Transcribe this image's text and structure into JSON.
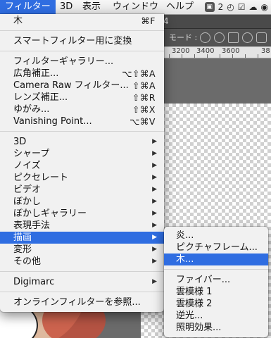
{
  "menubar": {
    "items": [
      "フィルター",
      "3D",
      "表示",
      "ウィンドウ",
      "ヘルプ"
    ],
    "active_index": 0,
    "tray": {
      "badge": "2"
    }
  },
  "document": {
    "tab_fragment": "4",
    "mode_label": "モード :",
    "ruler_labels": [
      "3200",
      "3400",
      "3600",
      "38"
    ]
  },
  "main_menu": {
    "group1": [
      {
        "label": "木",
        "shortcut": "⌘F"
      }
    ],
    "group2": [
      {
        "label": "スマートフィルター用に変換"
      }
    ],
    "group3": [
      {
        "label": "フィルターギャラリー..."
      },
      {
        "label": "広角補正...",
        "shortcut": "⌥⇧⌘A"
      },
      {
        "label": "Camera Raw フィルター...",
        "shortcut": "⇧⌘A"
      },
      {
        "label": "レンズ補正...",
        "shortcut": "⇧⌘R"
      },
      {
        "label": "ゆがみ...",
        "shortcut": "⇧⌘X"
      },
      {
        "label": "Vanishing Point...",
        "shortcut": "⌥⌘V"
      }
    ],
    "group4": [
      {
        "label": "3D"
      },
      {
        "label": "シャープ"
      },
      {
        "label": "ノイズ"
      },
      {
        "label": "ピクセレート"
      },
      {
        "label": "ビデオ"
      },
      {
        "label": "ぼかし"
      },
      {
        "label": "ぼかしギャラリー"
      },
      {
        "label": "表現手法"
      },
      {
        "label": "描画"
      },
      {
        "label": "変形"
      },
      {
        "label": "その他"
      }
    ],
    "group5": [
      {
        "label": "Digimarc"
      }
    ],
    "group6": [
      {
        "label": "オンラインフィルターを参照..."
      }
    ],
    "highlighted": "描画"
  },
  "sub_menu": {
    "group1": [
      {
        "label": "炎..."
      },
      {
        "label": "ピクチャフレーム..."
      },
      {
        "label": "木..."
      }
    ],
    "group2": [
      {
        "label": "ファイバー..."
      },
      {
        "label": "雲模様 1"
      },
      {
        "label": "雲模様 2"
      },
      {
        "label": "逆光..."
      },
      {
        "label": "照明効果..."
      }
    ],
    "highlighted": "木..."
  },
  "colors": {
    "highlight": "#2f6de1",
    "menu_bg": "#f1f1f1",
    "app_bg": "#535353"
  }
}
